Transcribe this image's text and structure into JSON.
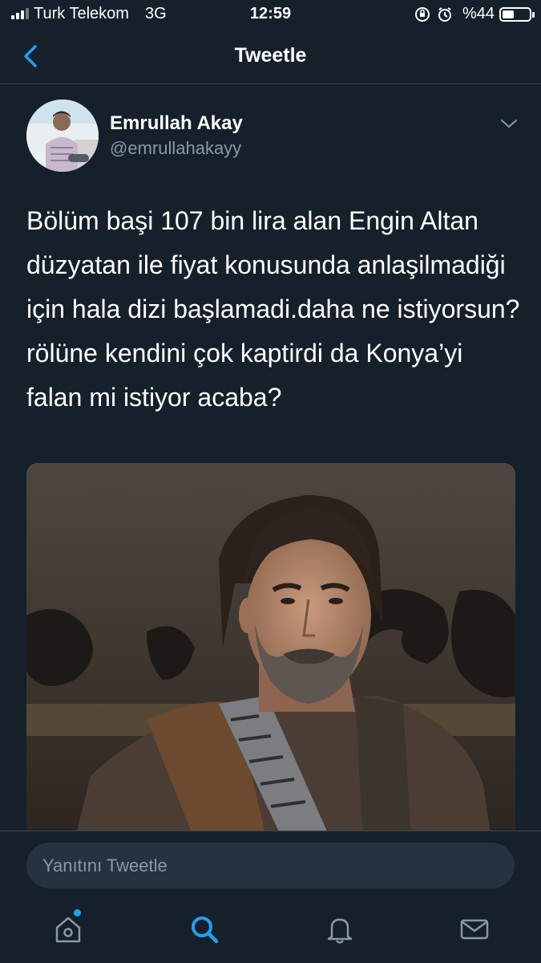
{
  "status_bar": {
    "carrier": "Turk Telekom",
    "network": "3G",
    "time": "12:59",
    "battery": "%44",
    "battery_level": 0.44
  },
  "header": {
    "title": "Tweetle",
    "back_icon": "chevron-left-icon"
  },
  "tweet": {
    "author_name": "Emrullah Akay",
    "author_handle": "@emrullahakayy",
    "text": "Bölüm başi 107 bin lira alan Engin Altan düzyatan ile fiyat konusunda anlaşilmadiği için hala dizi başlamadi.daha ne istiyorsun?rölüne kendini çok kaptirdi da Konya’yi falan mi istiyor acaba?"
  },
  "reply": {
    "placeholder": "Yanıtını Tweetle"
  },
  "tab_bar": {
    "items": [
      "home-icon",
      "search-icon",
      "bell-icon",
      "mail-icon"
    ],
    "accent": "#1da1f2"
  },
  "colors": {
    "background": "#15202b",
    "secondary_text": "#8899a6",
    "accent": "#1da1f2"
  }
}
